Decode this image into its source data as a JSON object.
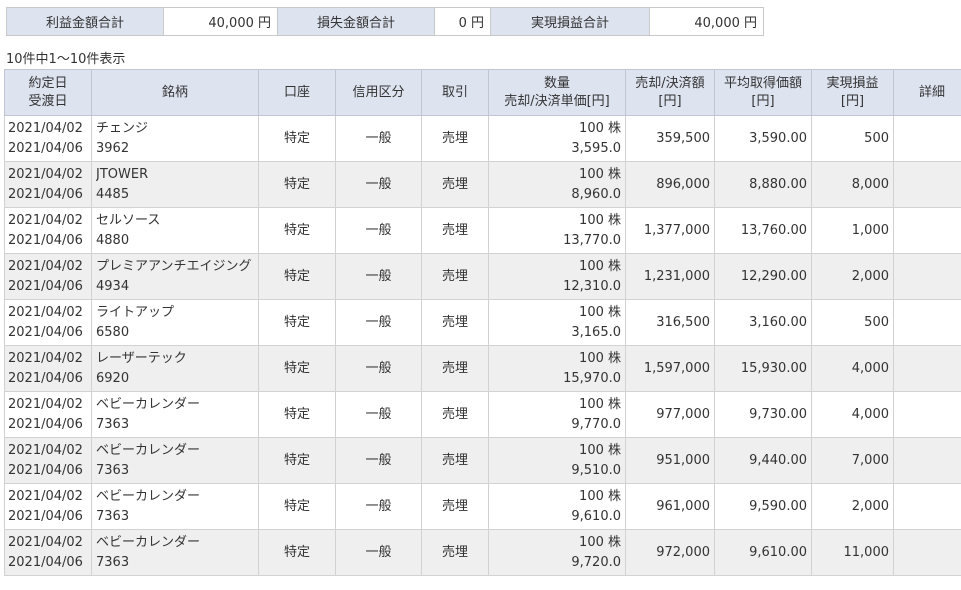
{
  "summary": {
    "profit_label": "利益金額合計",
    "profit_value": "40,000 円",
    "loss_label": "損失金額合計",
    "loss_value": "0 円",
    "realized_label": "実現損益合計",
    "realized_value": "40,000 円"
  },
  "result_count": "10件中1～10件表示",
  "table": {
    "headers": {
      "date_1": "約定日",
      "date_2": "受渡日",
      "stock": "銘柄",
      "account": "口座",
      "credit": "信用区分",
      "trade": "取引",
      "qty_1": "数量",
      "qty_2": "売却/決済単価[円]",
      "amount_1": "売却/決済額",
      "amount_2": "[円]",
      "avg_1": "平均取得価額",
      "avg_2": "[円]",
      "pl_1": "実現損益",
      "pl_2": "[円]",
      "detail": "詳細"
    },
    "rows": [
      {
        "trade_date": "2021/04/02",
        "settle_date": "2021/04/06",
        "name": "チェンジ",
        "code": "3962",
        "account": "特定",
        "credit": "一般",
        "trade": "売埋",
        "qty": "100 株",
        "price": "3,595.0",
        "amount": "359,500",
        "avg": "3,590.00",
        "pl": "500"
      },
      {
        "trade_date": "2021/04/02",
        "settle_date": "2021/04/06",
        "name": "JTOWER",
        "code": "4485",
        "account": "特定",
        "credit": "一般",
        "trade": "売埋",
        "qty": "100 株",
        "price": "8,960.0",
        "amount": "896,000",
        "avg": "8,880.00",
        "pl": "8,000"
      },
      {
        "trade_date": "2021/04/02",
        "settle_date": "2021/04/06",
        "name": "セルソース",
        "code": "4880",
        "account": "特定",
        "credit": "一般",
        "trade": "売埋",
        "qty": "100 株",
        "price": "13,770.0",
        "amount": "1,377,000",
        "avg": "13,760.00",
        "pl": "1,000"
      },
      {
        "trade_date": "2021/04/02",
        "settle_date": "2021/04/06",
        "name": "プレミアアンチエイジング",
        "code": "4934",
        "account": "特定",
        "credit": "一般",
        "trade": "売埋",
        "qty": "100 株",
        "price": "12,310.0",
        "amount": "1,231,000",
        "avg": "12,290.00",
        "pl": "2,000"
      },
      {
        "trade_date": "2021/04/02",
        "settle_date": "2021/04/06",
        "name": "ライトアップ",
        "code": "6580",
        "account": "特定",
        "credit": "一般",
        "trade": "売埋",
        "qty": "100 株",
        "price": "3,165.0",
        "amount": "316,500",
        "avg": "3,160.00",
        "pl": "500"
      },
      {
        "trade_date": "2021/04/02",
        "settle_date": "2021/04/06",
        "name": "レーザーテック",
        "code": "6920",
        "account": "特定",
        "credit": "一般",
        "trade": "売埋",
        "qty": "100 株",
        "price": "15,970.0",
        "amount": "1,597,000",
        "avg": "15,930.00",
        "pl": "4,000"
      },
      {
        "trade_date": "2021/04/02",
        "settle_date": "2021/04/06",
        "name": "ベビーカレンダー",
        "code": "7363",
        "account": "特定",
        "credit": "一般",
        "trade": "売埋",
        "qty": "100 株",
        "price": "9,770.0",
        "amount": "977,000",
        "avg": "9,730.00",
        "pl": "4,000"
      },
      {
        "trade_date": "2021/04/02",
        "settle_date": "2021/04/06",
        "name": "ベビーカレンダー",
        "code": "7363",
        "account": "特定",
        "credit": "一般",
        "trade": "売埋",
        "qty": "100 株",
        "price": "9,510.0",
        "amount": "951,000",
        "avg": "9,440.00",
        "pl": "7,000"
      },
      {
        "trade_date": "2021/04/02",
        "settle_date": "2021/04/06",
        "name": "ベビーカレンダー",
        "code": "7363",
        "account": "特定",
        "credit": "一般",
        "trade": "売埋",
        "qty": "100 株",
        "price": "9,610.0",
        "amount": "961,000",
        "avg": "9,590.00",
        "pl": "2,000"
      },
      {
        "trade_date": "2021/04/02",
        "settle_date": "2021/04/06",
        "name": "ベビーカレンダー",
        "code": "7363",
        "account": "特定",
        "credit": "一般",
        "trade": "売埋",
        "qty": "100 株",
        "price": "9,720.0",
        "amount": "972,000",
        "avg": "9,610.00",
        "pl": "11,000"
      }
    ]
  }
}
